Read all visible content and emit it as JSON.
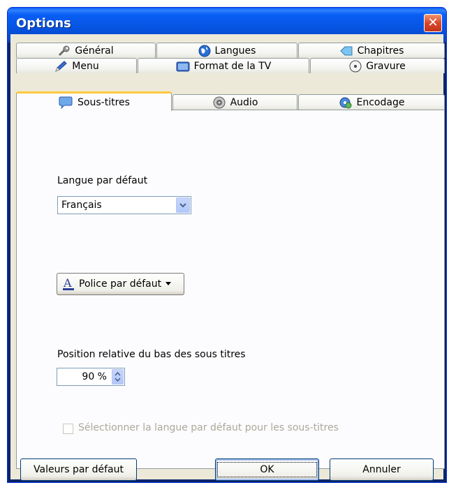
{
  "window": {
    "title": "Options",
    "close_glyph": "✕"
  },
  "tabs": {
    "row1": [
      {
        "label": "Général",
        "icon": "wrench-icon"
      },
      {
        "label": "Langues",
        "icon": "globe-icon"
      },
      {
        "label": "Chapitres",
        "icon": "chapter-icon"
      }
    ],
    "row2": [
      {
        "label": "Menu",
        "icon": "pen-icon"
      },
      {
        "label": "Format de la TV",
        "icon": "tv-icon"
      },
      {
        "label": "Gravure",
        "icon": "disc-icon"
      }
    ],
    "row3": [
      {
        "label": "Sous-titres",
        "icon": "speech-bubble-icon",
        "active": true
      },
      {
        "label": "Audio",
        "icon": "speaker-icon"
      },
      {
        "label": "Encodage",
        "icon": "encode-gear-icon"
      }
    ]
  },
  "subtitles": {
    "default_language_label": "Langue par défaut",
    "default_language_value": "Français",
    "font_button_label": "Police par défaut",
    "position_label": "Position relative du bas des sous titres",
    "position_value": "90 %",
    "checkbox_label": "Sélectionner la langue par défaut pour les sous-titres",
    "checkbox_checked": false,
    "checkbox_enabled": false
  },
  "buttons": {
    "defaults_label": "Valeurs par défaut",
    "ok_label": "OK",
    "cancel_label": "Annuler"
  },
  "colors": {
    "title_bar": "#0a5ef5",
    "active_tab_accent": "#ffc83c",
    "close_button": "#d8462a"
  }
}
